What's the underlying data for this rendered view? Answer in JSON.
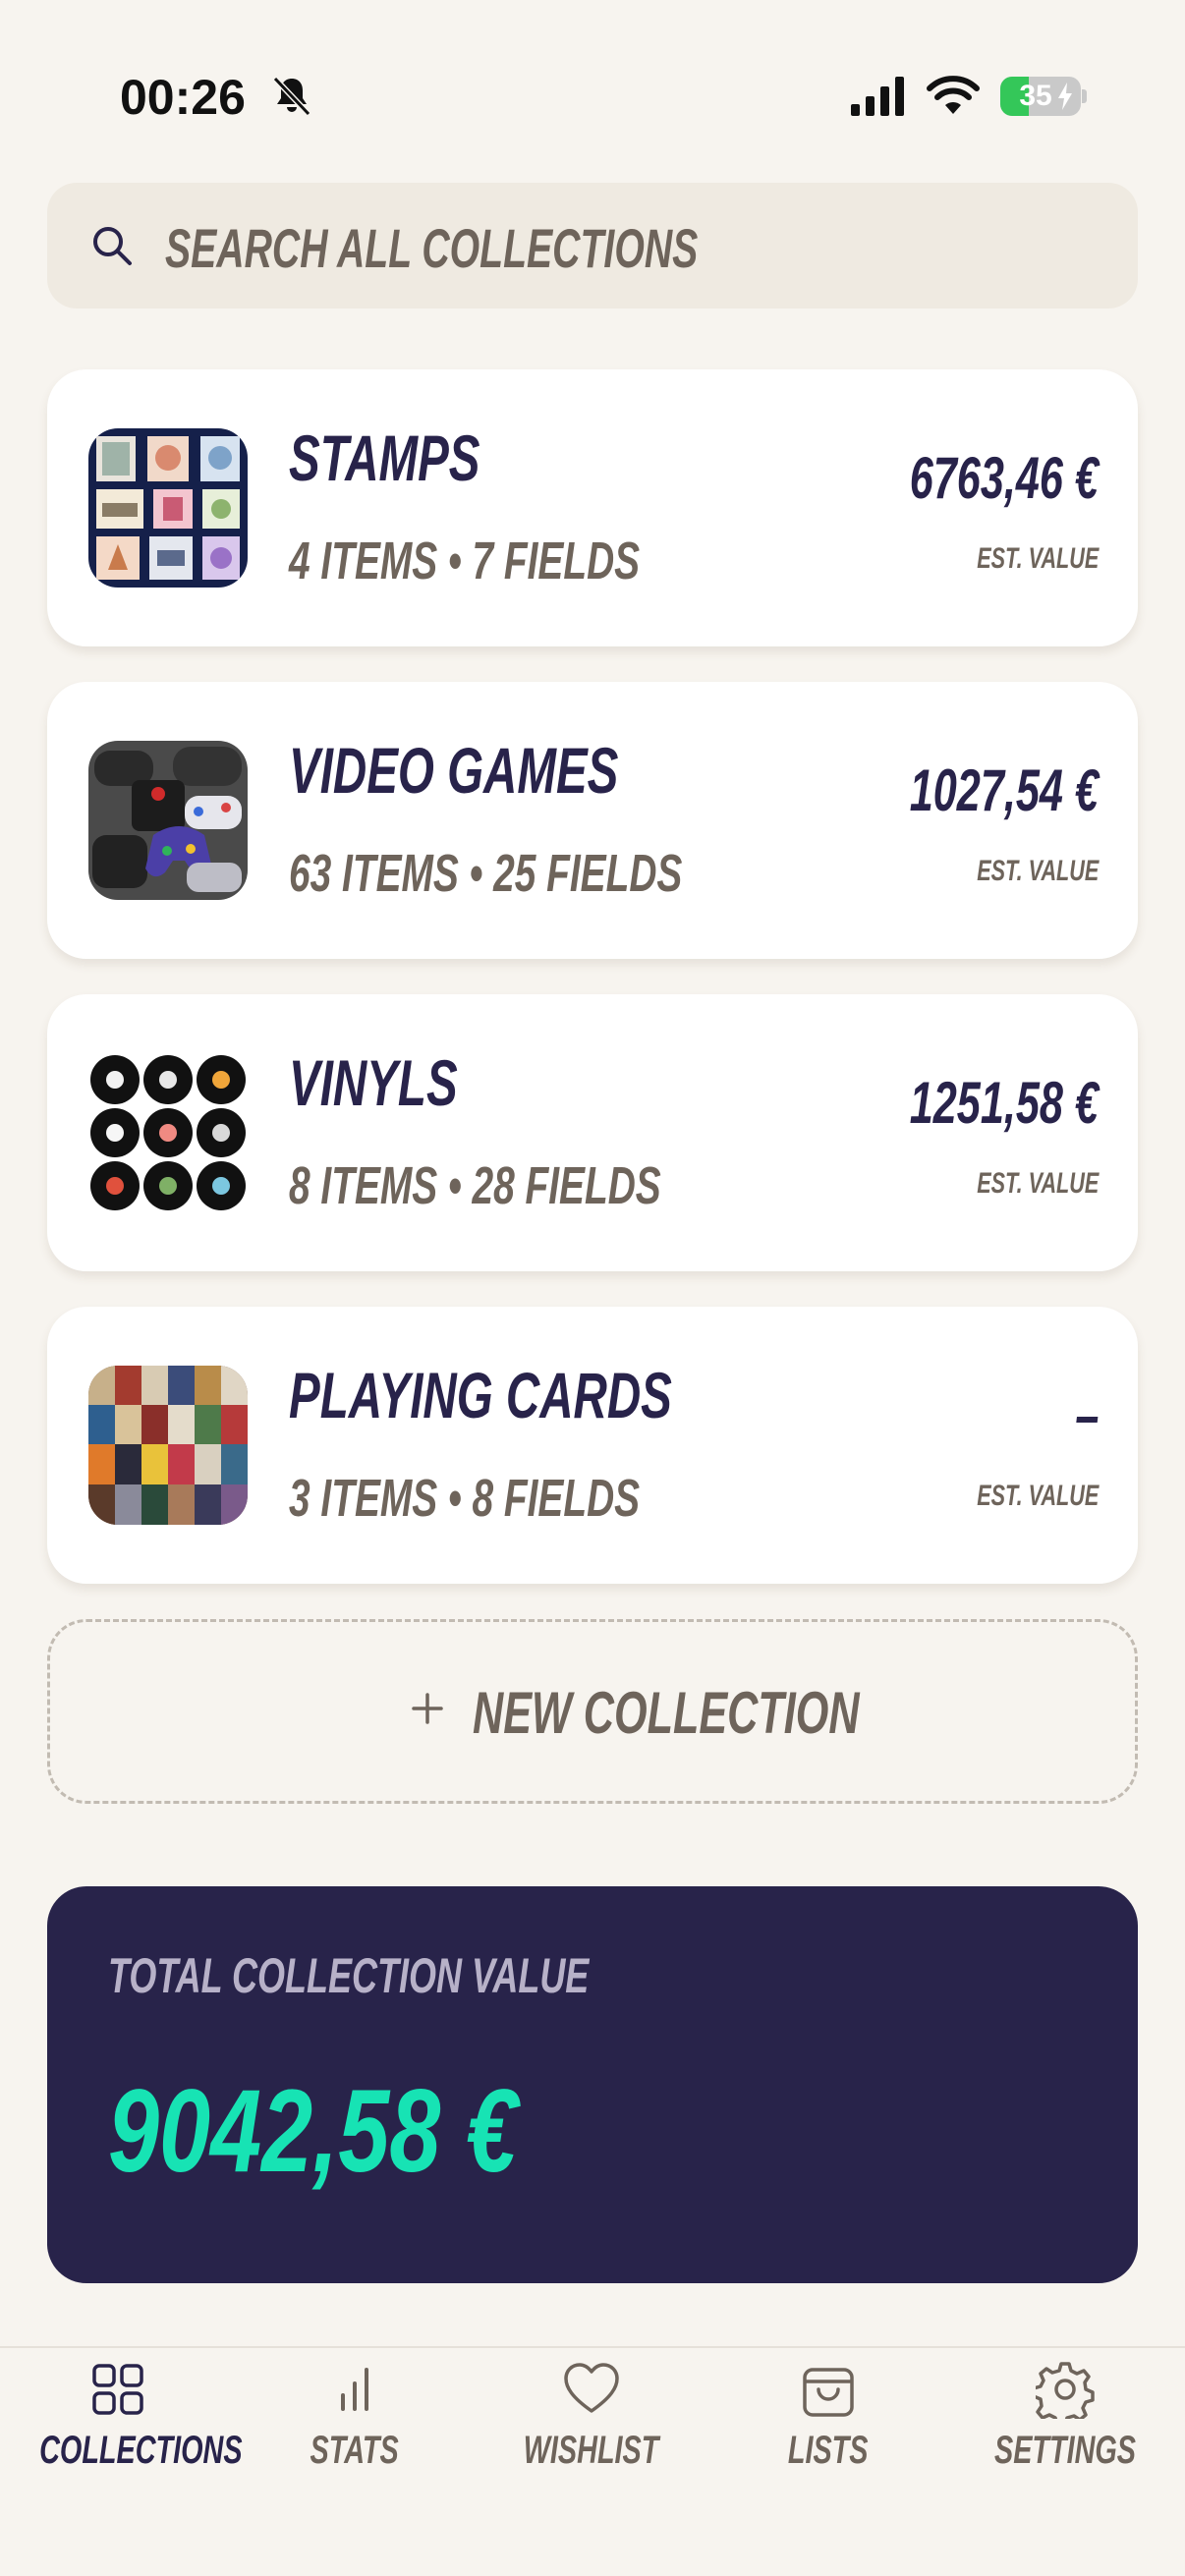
{
  "status_bar": {
    "time": "00:26",
    "battery": "35",
    "battery_level": 0.35
  },
  "search": {
    "placeholder": "SEARCH ALL COLLECTIONS",
    "icon": "search-icon"
  },
  "collections": [
    {
      "name": "STAMPS",
      "meta": "4 ITEMS • 7 FIELDS",
      "value": "6763,46 €",
      "value_label": "EST. VALUE",
      "thumb": "stamps-thumbnail"
    },
    {
      "name": "VIDEO GAMES",
      "meta": "63 ITEMS • 25 FIELDS",
      "value": "1027,54 €",
      "value_label": "EST. VALUE",
      "thumb": "video-games-thumbnail"
    },
    {
      "name": "VINYLS",
      "meta": "8 ITEMS • 28 FIELDS",
      "value": "1251,58 €",
      "value_label": "EST. VALUE",
      "thumb": "vinyls-thumbnail"
    },
    {
      "name": "PLAYING CARDS",
      "meta": "3 ITEMS • 8 FIELDS",
      "value": "–",
      "value_label": "EST. VALUE",
      "thumb": "playing-cards-thumbnail"
    }
  ],
  "new_collection": {
    "label": "NEW COLLECTION",
    "icon": "plus-icon"
  },
  "total": {
    "label": "TOTAL COLLECTION VALUE",
    "value": "9042,58 €"
  },
  "tabs": [
    {
      "label": "COLLECTIONS",
      "icon": "grid-icon",
      "active": true
    },
    {
      "label": "STATS",
      "icon": "bar-chart-icon",
      "active": false
    },
    {
      "label": "WISHLIST",
      "icon": "heart-icon",
      "active": false
    },
    {
      "label": "LISTS",
      "icon": "bag-icon",
      "active": false
    },
    {
      "label": "SETTINGS",
      "icon": "gear-icon",
      "active": false
    }
  ],
  "colors": {
    "background": "#f7f4ef",
    "navy": "#28234a",
    "muted": "#6e645b",
    "accent": "#17e3b4",
    "battery_green": "#34c759"
  }
}
